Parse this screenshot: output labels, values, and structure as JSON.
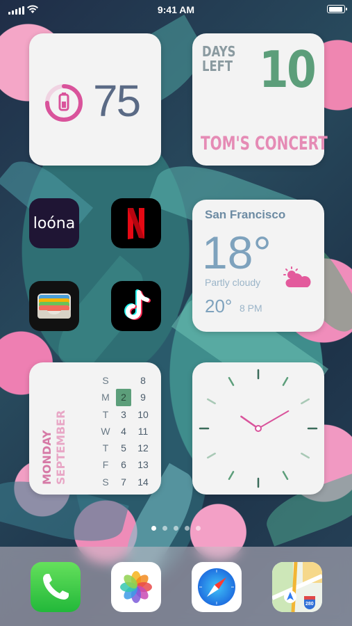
{
  "status_bar": {
    "time": "9:41 AM"
  },
  "battery_widget": {
    "percent": "75",
    "level": 0.75,
    "ring_color": "#d9539b"
  },
  "countdown_widget": {
    "label_line1": "DAYS",
    "label_line2": "LEFT",
    "days": "10",
    "event": "TOM'S CONCERT"
  },
  "weather_widget": {
    "city": "San Francisco",
    "temperature": "18°",
    "condition": "Partly cloudy",
    "next_temp": "20°",
    "next_time": "8 PM",
    "icon": "partly-cloudy-icon"
  },
  "calendar_widget": {
    "weekday": "MONDAY",
    "month": "SEPTEMBER",
    "day_letters": [
      "S",
      "M",
      "T",
      "W",
      "T",
      "F",
      "S"
    ],
    "week1": [
      "",
      "2",
      "3",
      "4",
      "5",
      "6",
      "7"
    ],
    "week2": [
      "8",
      "9",
      "10",
      "11",
      "12",
      "13",
      "14"
    ],
    "today": "2"
  },
  "clock_widget": {
    "hour": 10,
    "minute": 10,
    "hand_color": "#d9539b"
  },
  "apps": [
    {
      "name": "loóna",
      "icon": "loona-icon"
    },
    {
      "name": "Netflix",
      "icon": "netflix-icon"
    },
    {
      "name": "Wallet",
      "icon": "wallet-icon"
    },
    {
      "name": "TikTok",
      "icon": "tiktok-icon"
    }
  ],
  "page_dots": {
    "count": 5,
    "active": 0
  },
  "dock": [
    {
      "name": "Phone",
      "icon": "phone-icon"
    },
    {
      "name": "Photos",
      "icon": "photos-icon"
    },
    {
      "name": "Safari",
      "icon": "safari-icon"
    },
    {
      "name": "Maps",
      "icon": "maps-icon",
      "badge": "280"
    }
  ]
}
